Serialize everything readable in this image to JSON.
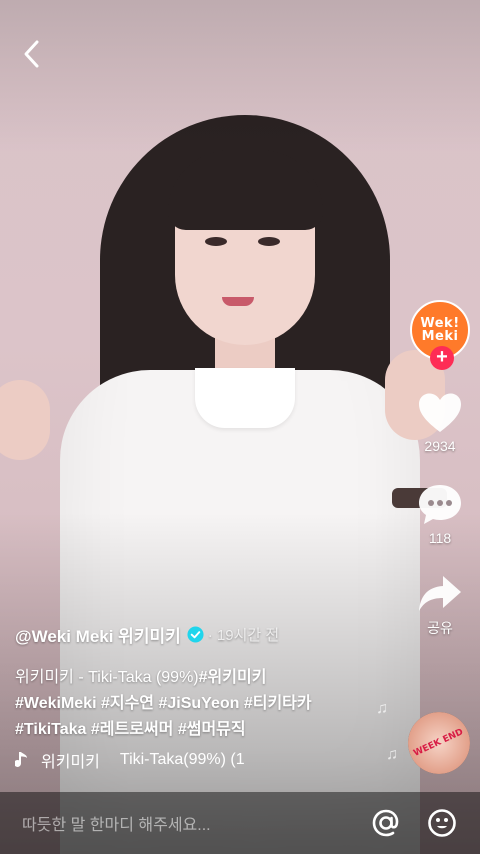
{
  "nav": {
    "back_icon": "chevron-left-icon"
  },
  "creator": {
    "avatar_logo_line1": "Wek!",
    "avatar_logo_line2": "Meki",
    "follow_icon": "plus-icon"
  },
  "actions": {
    "likes": "2934",
    "comments": "118",
    "share_label": "공유"
  },
  "post": {
    "author": "@Weki Meki 위키미키",
    "time": "· 19시간 전",
    "caption_line1_plain": "위키미키 - Tiki-Taka (99%)",
    "caption_line1_tag": "#위키미키",
    "caption_line2": "#WekiMeki #지수연 #JiSuYeon #티키타카",
    "caption_line3": "#TikiTaka #레트로써머 #썸머뮤직"
  },
  "music": {
    "artist": "위키미키",
    "title": "Tiki-Taka(99%) (1",
    "disc_text": "WEEK END"
  },
  "comment_bar": {
    "placeholder": "따듯한 말 한마디 해주세요..."
  },
  "colors": {
    "accent": "#fe2c55",
    "verified": "#20d5ec"
  }
}
